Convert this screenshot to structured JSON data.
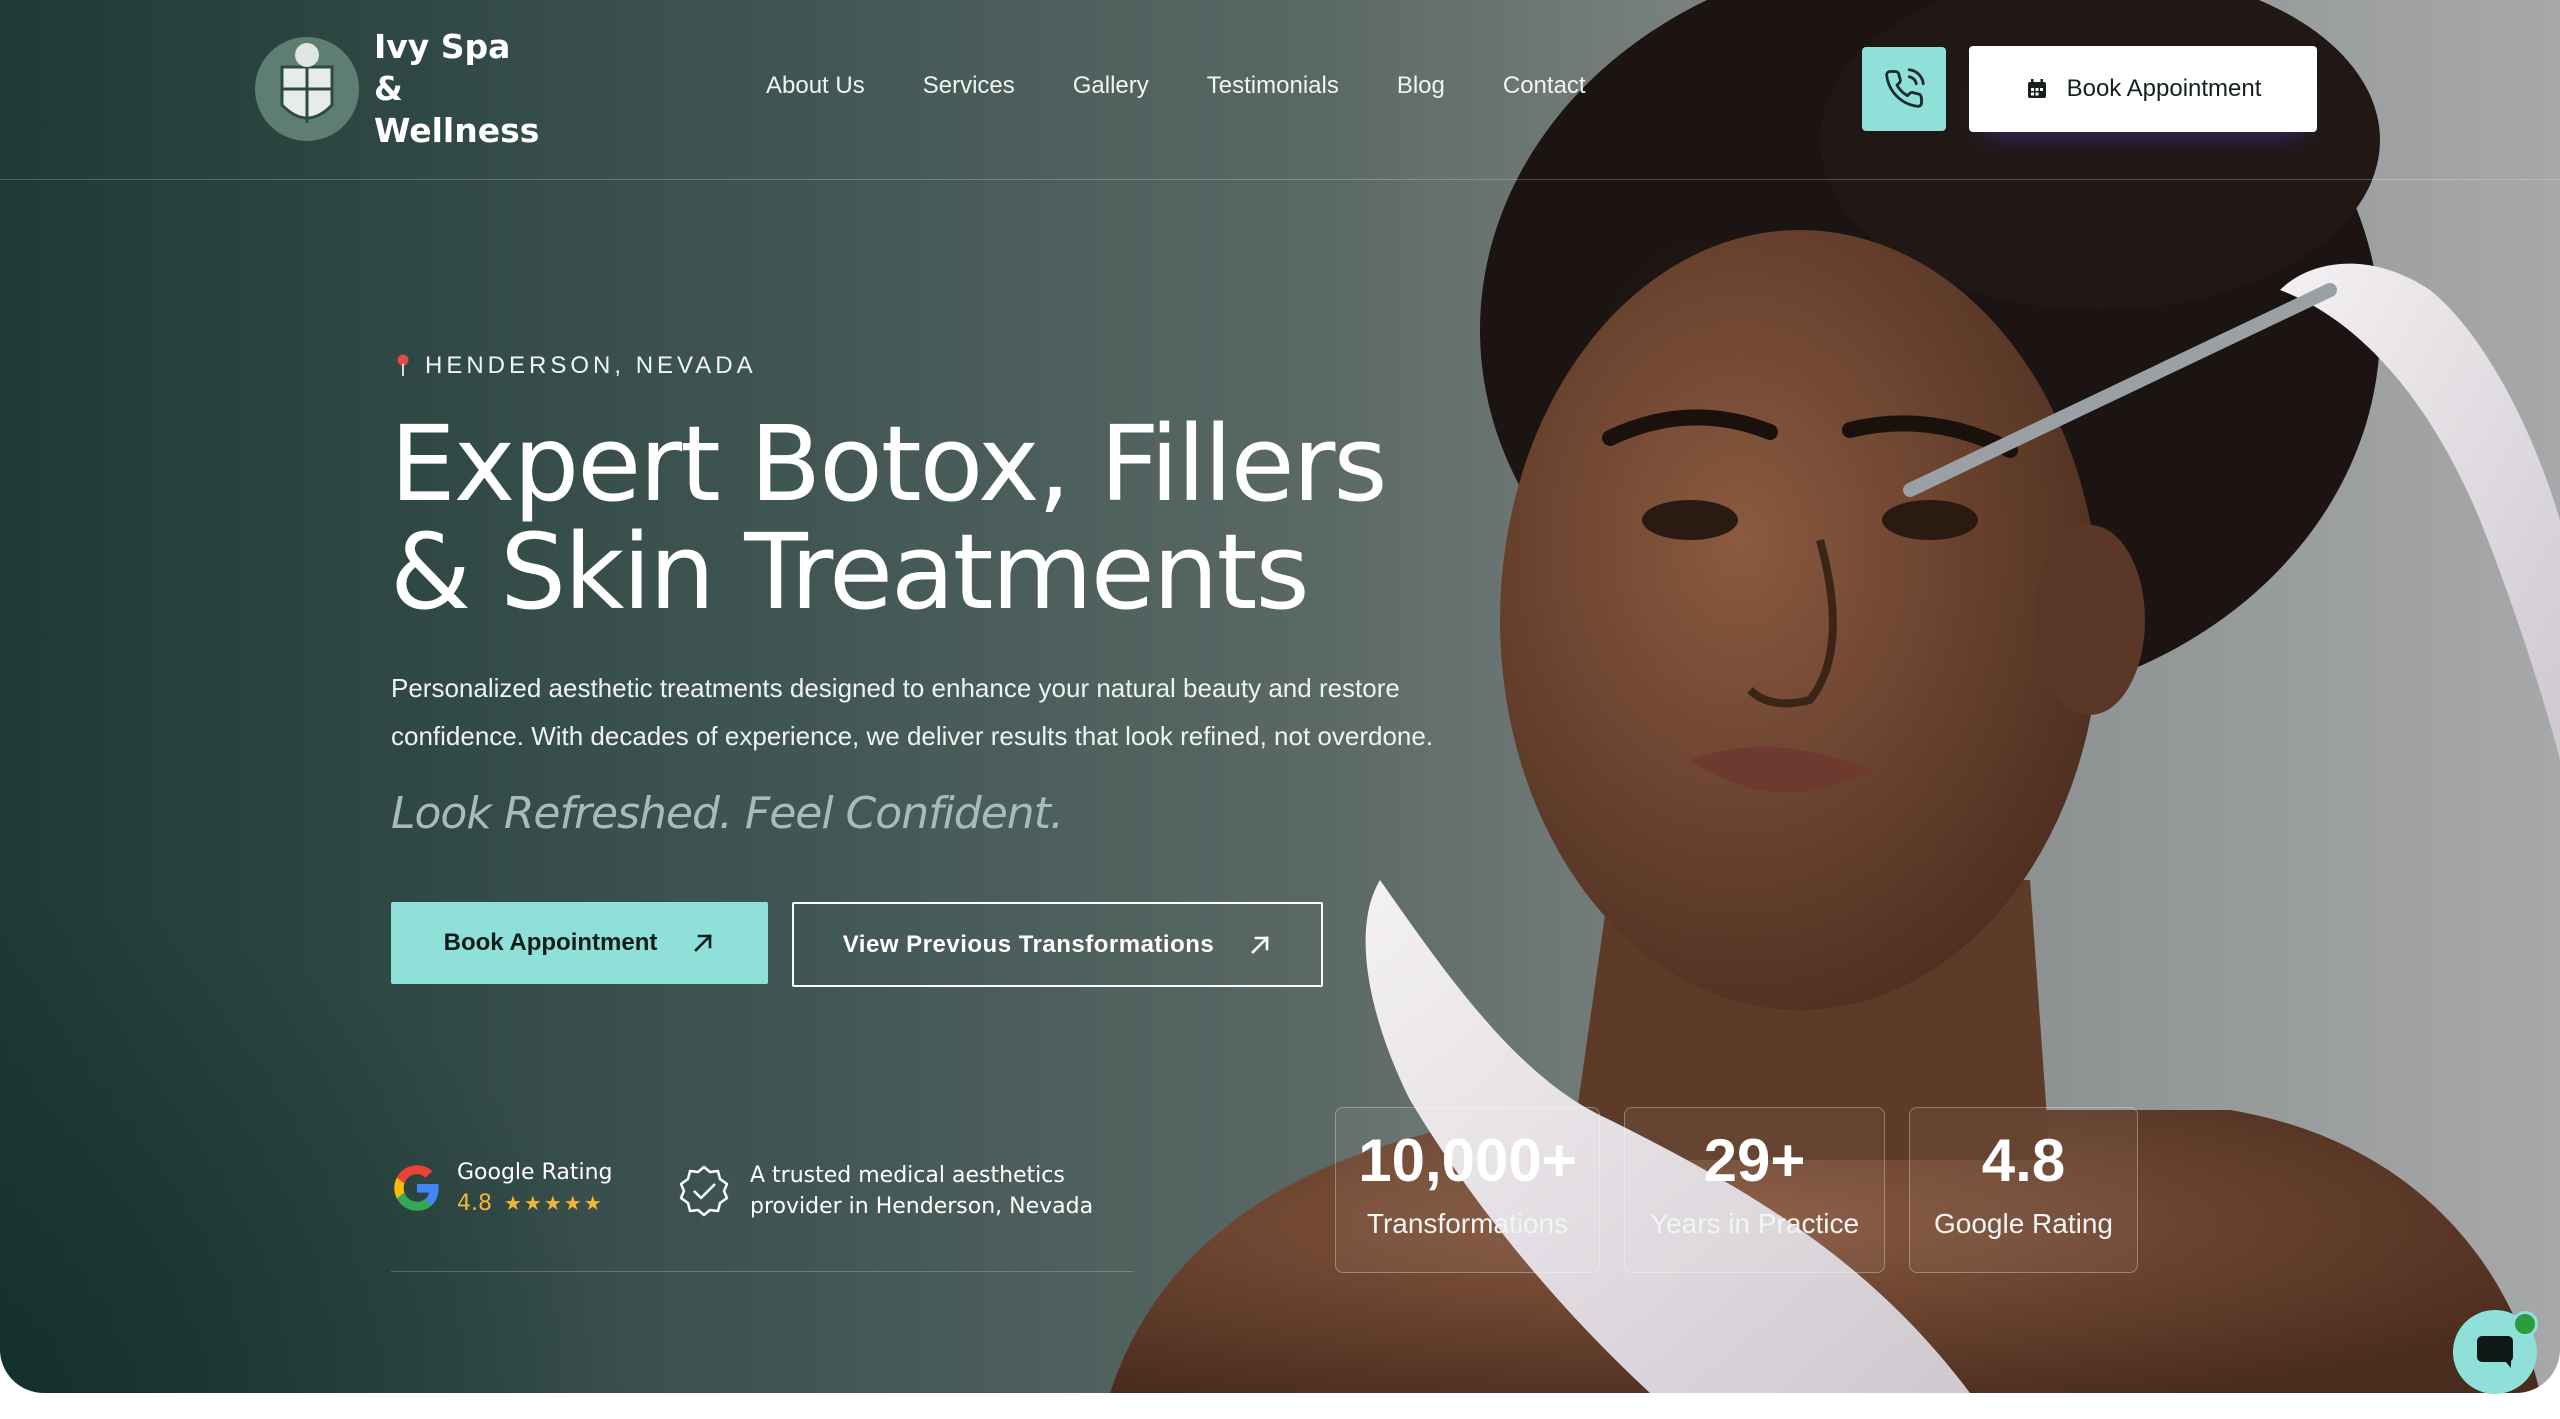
{
  "brand": {
    "name": "Ivy Spa & Wellness"
  },
  "nav": {
    "items": [
      {
        "label": "About Us"
      },
      {
        "label": "Services"
      },
      {
        "label": "Gallery"
      },
      {
        "label": "Testimonials"
      },
      {
        "label": "Blog"
      },
      {
        "label": "Contact"
      }
    ],
    "book_label": "Book Appointment"
  },
  "hero": {
    "location": "HENDERSON, NEVADA",
    "headline_line1": "Expert Botox, Fillers",
    "headline_line2": "& Skin Treatments",
    "subtext": "Personalized aesthetic treatments designed to enhance your natural beauty and restore confidence. With decades of experience, we deliver results that look refined, not overdone.",
    "tagline": "Look Refreshed. Feel Confident.",
    "cta_primary": "Book Appointment",
    "cta_secondary": "View Previous Transformations"
  },
  "trust": {
    "google_label": "Google Rating",
    "google_value": "4.8",
    "stars": "★★★★★",
    "trusted_text": "A trusted medical aesthetics provider in Henderson, Nevada"
  },
  "stats": [
    {
      "value": "10,000+",
      "label": "Transformations"
    },
    {
      "value": "29+",
      "label": "Years in Practice"
    },
    {
      "value": "4.8",
      "label": "Google Rating"
    }
  ],
  "colors": {
    "accent": "#8fe0d9",
    "dark": "#1f3a36",
    "star": "#f1b53a"
  },
  "icons": {
    "logo": "crest-icon",
    "phone": "phone-icon",
    "calendar": "calendar-icon",
    "location": "map-pin-icon",
    "arrow": "arrow-up-right-icon",
    "google": "google-g-icon",
    "badge": "verified-badge-icon",
    "chat": "chat-bubble-icon"
  }
}
